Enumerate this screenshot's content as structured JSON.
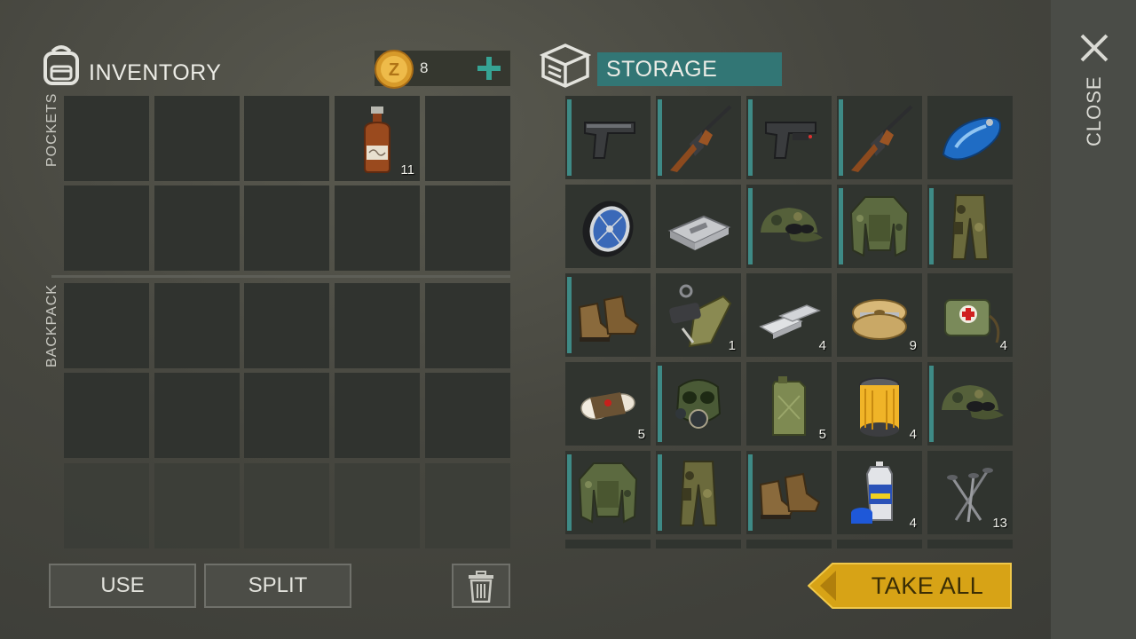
{
  "inventory": {
    "title": "INVENTORY",
    "coins": "8",
    "pockets_label": "POCKETS",
    "backpack_label": "BACKPACK",
    "pocket_items": [
      {
        "slot": 3,
        "icon": "bottle-icon",
        "count": "11"
      }
    ]
  },
  "storage": {
    "title": "STORAGE",
    "items": [
      {
        "icon": "pistol-icon",
        "count": "",
        "marked": true
      },
      {
        "icon": "assault-rifle-icon",
        "count": "",
        "marked": true
      },
      {
        "icon": "pistol-laser-icon",
        "count": "",
        "marked": true
      },
      {
        "icon": "assault-rifle-icon",
        "count": "",
        "marked": true
      },
      {
        "icon": "fuel-tank-icon",
        "count": "",
        "marked": false
      },
      {
        "icon": "wheel-icon",
        "count": "",
        "marked": false
      },
      {
        "icon": "ecu-box-icon",
        "count": "",
        "marked": false
      },
      {
        "icon": "camo-cap-icon",
        "count": "",
        "marked": true
      },
      {
        "icon": "camo-jacket-icon",
        "count": "",
        "marked": true
      },
      {
        "icon": "camo-pants-icon",
        "count": "",
        "marked": true
      },
      {
        "icon": "boots-icon",
        "count": "",
        "marked": true
      },
      {
        "icon": "muzzle-magazine-icon",
        "count": "1",
        "marked": false
      },
      {
        "icon": "metal-bars-icon",
        "count": "4",
        "marked": false
      },
      {
        "icon": "wire-spool-icon",
        "count": "9",
        "marked": false
      },
      {
        "icon": "medkit-bag-icon",
        "count": "4",
        "marked": false
      },
      {
        "icon": "bandage-icon",
        "count": "5",
        "marked": false
      },
      {
        "icon": "gas-mask-icon",
        "count": "",
        "marked": true
      },
      {
        "icon": "jerrycan-icon",
        "count": "5",
        "marked": false
      },
      {
        "icon": "oil-filter-icon",
        "count": "4",
        "marked": false
      },
      {
        "icon": "camo-cap-icon",
        "count": "",
        "marked": true
      },
      {
        "icon": "camo-jacket-icon",
        "count": "",
        "marked": true
      },
      {
        "icon": "camo-pants-icon",
        "count": "",
        "marked": true
      },
      {
        "icon": "boots-icon",
        "count": "",
        "marked": true
      },
      {
        "icon": "spray-paint-icon",
        "count": "4",
        "marked": false
      },
      {
        "icon": "nails-icon",
        "count": "13",
        "marked": false
      }
    ]
  },
  "buttons": {
    "use": "USE",
    "split": "SPLIT",
    "take_all": "TAKE ALL",
    "close": "CLOSE"
  },
  "colors": {
    "accent_teal": "#3e8a86",
    "gold": "#d7a316"
  }
}
